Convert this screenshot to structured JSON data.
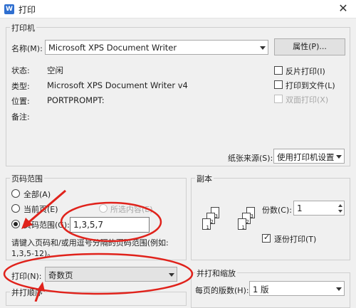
{
  "window": {
    "title": "打印",
    "app_icon": "W"
  },
  "printer": {
    "group_title": "打印机",
    "name_label": "名称(M):",
    "name_value": "Microsoft XPS Document Writer",
    "properties_button": "属性(P)...",
    "status_label": "状态:",
    "status_value": "空闲",
    "type_label": "类型:",
    "type_value": "Microsoft XPS Document Writer v4",
    "location_label": "位置:",
    "location_value": "PORTPROMPT:",
    "comment_label": "备注:",
    "reverse_print": "反片打印(I)",
    "print_to_file": "打印到文件(L)",
    "duplex": "双面打印(X)",
    "paper_source_label": "纸张来源(S):",
    "paper_source_value": "使用打印机设置"
  },
  "page_range": {
    "group_title": "页码范围",
    "all": "全部(A)",
    "current": "当前页(E)",
    "selection": "所选内容(E)",
    "pages": "页码范围(G):",
    "pages_value": "1,3,5,7",
    "hint": "请键入页码和/或用逗号分隔的页码范围(例如:",
    "hint2": "1,3,5-12)。"
  },
  "print_what": {
    "label": "打印(N):",
    "value": "奇数页"
  },
  "collate_group": {
    "title": "并打顺序"
  },
  "copies": {
    "group_title": "副本",
    "count_label": "份数(C):",
    "count_value": "1",
    "collate": "逐份打印(T)",
    "page_numbers": [
      "1",
      "2",
      "3",
      "1",
      "2",
      "3"
    ]
  },
  "scale": {
    "group_title": "并打和缩放",
    "pages_per_sheet_label": "每页的版数(H):",
    "pages_per_sheet_value": "1 版"
  }
}
